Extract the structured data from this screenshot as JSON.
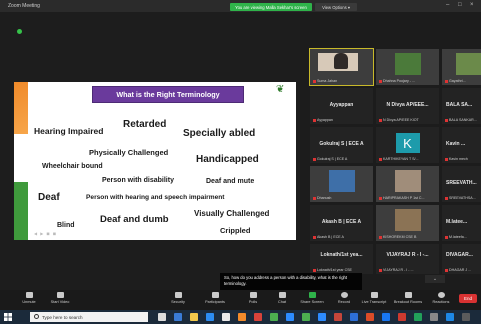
{
  "titlebar": {
    "app_name": "Zoom Meeting",
    "share_banner": "You are viewing Malla Sekhar's screen",
    "view_options": "View Options ▾"
  },
  "slide": {
    "title": "What is the Right Terminology",
    "terms": [
      {
        "text": "Hearing Impaired"
      },
      {
        "text": "Retarded"
      },
      {
        "text": "Specially abled"
      },
      {
        "text": "Physically Challenged"
      },
      {
        "text": "Handicapped"
      },
      {
        "text": "Wheelchair bound"
      },
      {
        "text": "Person with disability"
      },
      {
        "text": "Deaf and mute"
      },
      {
        "text": "Deaf"
      },
      {
        "text": "Person with hearing and speech impairment"
      },
      {
        "text": "Visually Challenged"
      },
      {
        "text": "Deaf and dumb"
      },
      {
        "text": "Blind"
      },
      {
        "text": "Crippled"
      }
    ]
  },
  "gallery": {
    "tiles": [
      {
        "center": "",
        "foot": "Suma Jahan",
        "type": "video"
      },
      {
        "center": "",
        "foot": "Dhahna Poojary - ...",
        "type": "photo"
      },
      {
        "center": "",
        "foot": "Gayathri...",
        "type": "photo"
      },
      {
        "center": "Ayyappan",
        "foot": "Ayyappan",
        "type": "name"
      },
      {
        "center": "N Divya AP/EEE...",
        "foot": "N Divya AP/EEE KIOT",
        "type": "name"
      },
      {
        "center": "BALA SA...",
        "foot": "BALA SANKAR...",
        "type": "name"
      },
      {
        "center": "Gokulraj S | ECE A",
        "foot": "Gokulraj S | ECE A",
        "type": "name"
      },
      {
        "center": "",
        "foot": "KARTHIKEYAN T S/...",
        "type": "avatar",
        "letter": "K"
      },
      {
        "center": "Kavin ...",
        "foot": "Kavin mech",
        "type": "name"
      },
      {
        "center": "",
        "foot": "Dhanush",
        "type": "photo"
      },
      {
        "center": "",
        "foot": "HARIPRAKASH P 1st C...",
        "type": "photo"
      },
      {
        "center": "SREEVATH...",
        "foot": "SREEVATHSA...",
        "type": "name"
      },
      {
        "center": "Akash B | ECE A",
        "foot": "Akash B | ECE A",
        "type": "name"
      },
      {
        "center": "",
        "foot": "KISHOREKM CSE B",
        "type": "photo"
      },
      {
        "center": "M.latee...",
        "foot": "M.lateefa...",
        "type": "name"
      },
      {
        "center": "Loknath/1st yea...",
        "foot": "Loknath/1st year CSE",
        "type": "name"
      },
      {
        "center": "VIJAYRAJ R - I -...",
        "foot": "VIJAYRAJ R - I - ...",
        "type": "name"
      },
      {
        "center": "DIVAGAR...",
        "foot": "DHAGAR J ...",
        "type": "name"
      }
    ]
  },
  "caption": "So, how do you address a person with a disability, what is the right terminology.",
  "toolbar": {
    "buttons": [
      {
        "label": "Unmute",
        "color": "#c9c9c9"
      },
      {
        "label": "Start Video",
        "color": "#c9c9c9"
      },
      {
        "label": "Security",
        "color": "#c9c9c9"
      },
      {
        "label": "Participants",
        "color": "#c9c9c9"
      },
      {
        "label": "Polls",
        "color": "#c9c9c9"
      },
      {
        "label": "Chat",
        "color": "#c9c9c9"
      },
      {
        "label": "Share Screen",
        "color": "#2fb34a"
      },
      {
        "label": "Record",
        "color": "#c9c9c9"
      },
      {
        "label": "Live Transcript",
        "color": "#c9c9c9"
      },
      {
        "label": "Breakout Rooms",
        "color": "#c9c9c9"
      },
      {
        "label": "Reactions",
        "color": "#c9c9c9"
      }
    ],
    "end_label": "End"
  },
  "taskbar": {
    "search_placeholder": "Type here to search"
  }
}
